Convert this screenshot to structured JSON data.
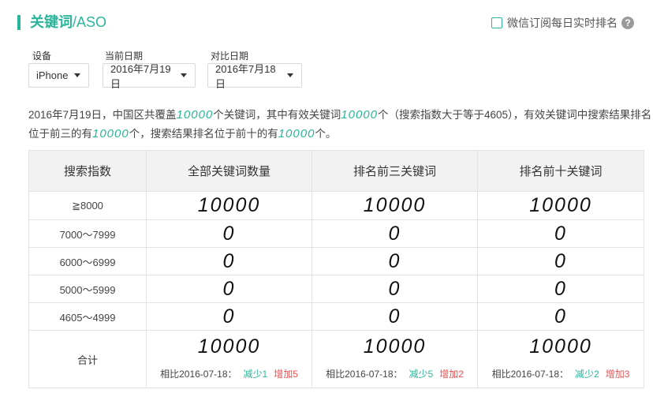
{
  "header": {
    "title_main": "关键词",
    "title_suffix": "/ASO",
    "subscribe_label": "微信订阅每日实时排名",
    "help_glyph": "?"
  },
  "filters": {
    "device": {
      "label": "设备",
      "value": "iPhone"
    },
    "current_date": {
      "label": "当前日期",
      "value": "2016年7月19日"
    },
    "compare_date": {
      "label": "对比日期",
      "value": "2016年7月18日"
    }
  },
  "summary": {
    "p1": "2016年7月19日，中国区共覆盖",
    "n1": "10000",
    "p2": "个关键词，其中有效关键词",
    "n2": "10000",
    "p3": "个（搜索指数大于等于4605），有效关键词中搜索结果排名位于前三的有",
    "n3": "10000",
    "p4": "个，搜索结果排名位于前十的有",
    "n4": "10000",
    "p5": "个。"
  },
  "table": {
    "headers": [
      "搜索指数",
      "全部关键词数量",
      "排名前三关键词",
      "排名前十关键词"
    ],
    "rows": [
      {
        "range": "≧8000",
        "all": "10000",
        "top3": "10000",
        "top10": "10000"
      },
      {
        "range": "7000～7999",
        "all": "0",
        "top3": "0",
        "top10": "0"
      },
      {
        "range": "6000～6999",
        "all": "0",
        "top3": "0",
        "top10": "0"
      },
      {
        "range": "5000～5999",
        "all": "0",
        "top3": "0",
        "top10": "0"
      },
      {
        "range": "4605～4999",
        "all": "0",
        "top3": "0",
        "top10": "0"
      }
    ],
    "total": {
      "label": "合计",
      "cols": [
        {
          "value": "10000",
          "compare": "相比2016-07-18：",
          "dec": "减少1",
          "inc": "增加5"
        },
        {
          "value": "10000",
          "compare": "相比2016-07-18：",
          "dec": "减少5",
          "inc": "增加2"
        },
        {
          "value": "10000",
          "compare": "相比2016-07-18：",
          "dec": "减少2",
          "inc": "增加3"
        }
      ]
    }
  },
  "colors": {
    "accent": "#2bb59a",
    "increase": "#e55353",
    "header_bg": "#f2f2f2"
  }
}
